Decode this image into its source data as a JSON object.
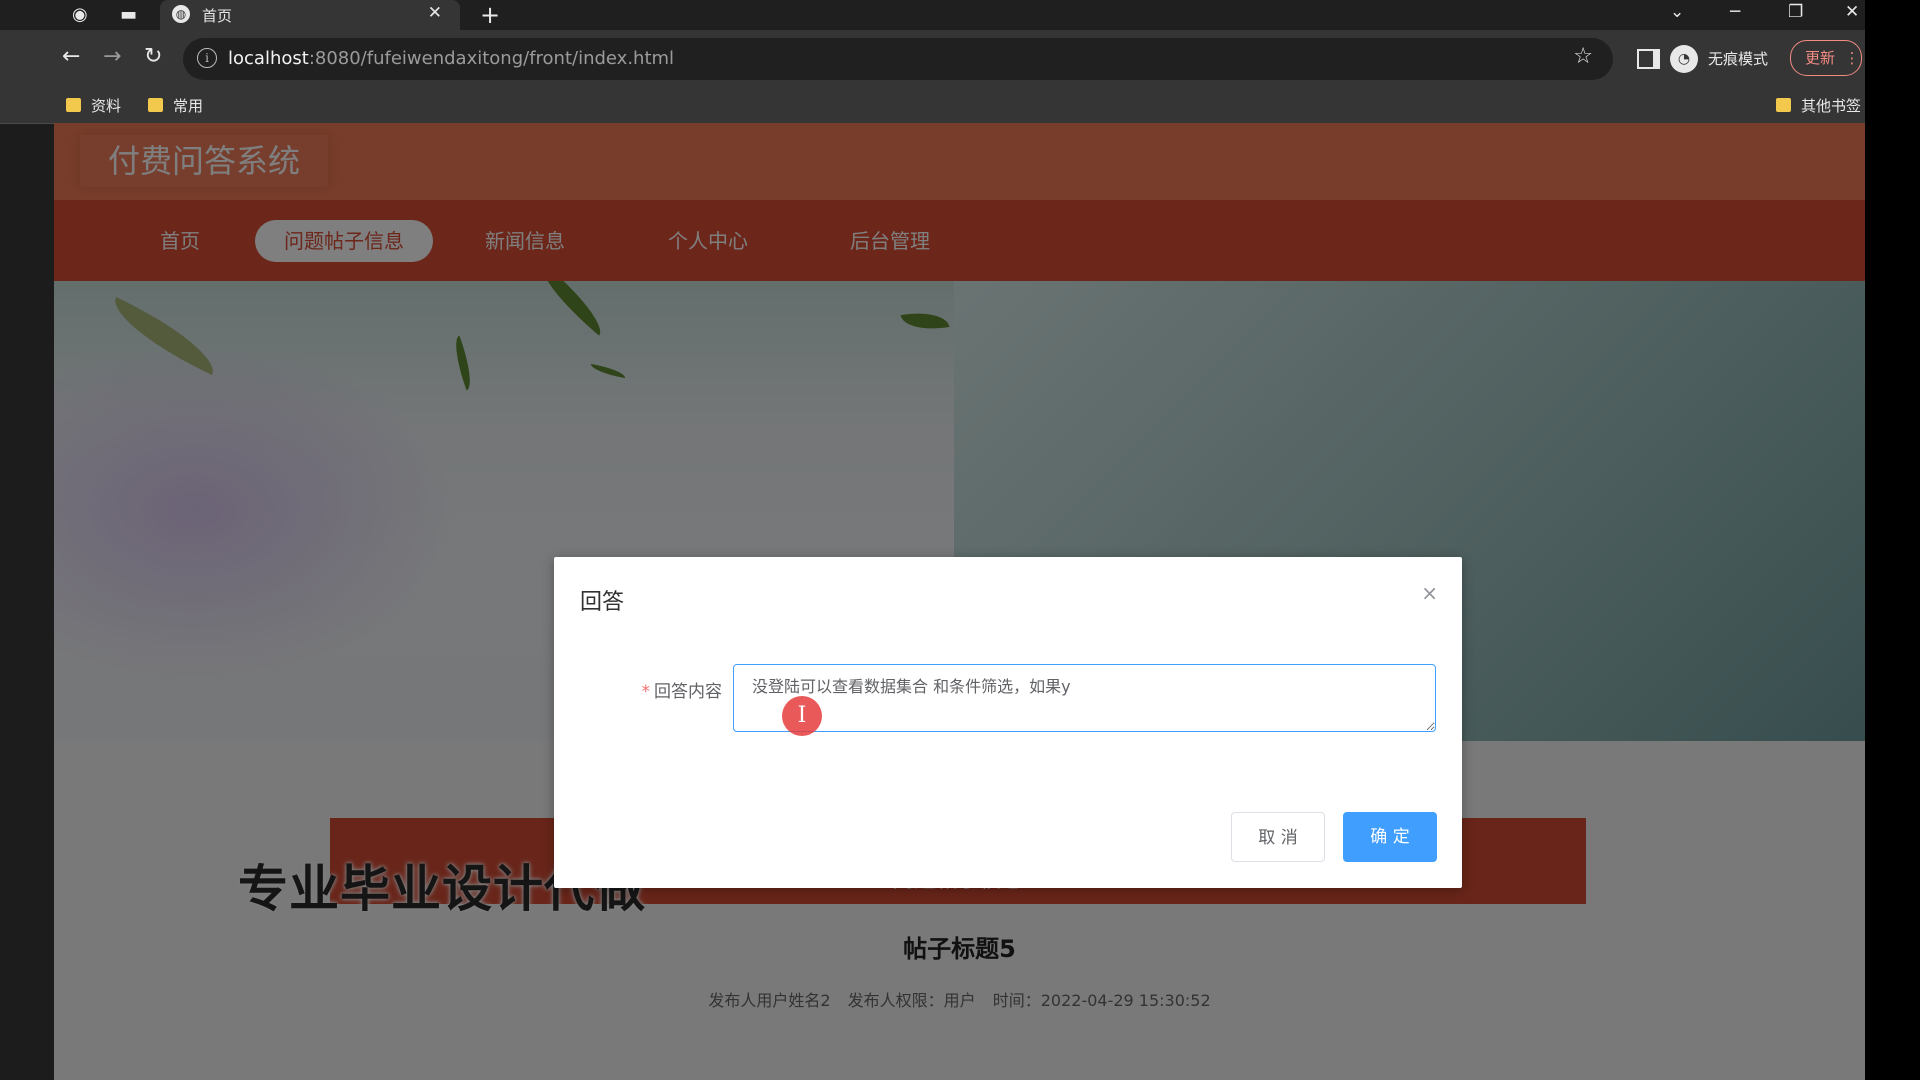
{
  "browser": {
    "tab_title": "首页",
    "tab_close": "✕",
    "new_tab": "+",
    "url_host": "localhost",
    "url_rest": ":8080/fufeiwendaxitong/front/index.html",
    "incognito_label": "无痕模式",
    "update_label": "更新",
    "bookmarks": [
      "资料",
      "常用"
    ],
    "other_bookmarks": "其他书签"
  },
  "site": {
    "logo": "付费问答系统",
    "nav": [
      "首页",
      "问题帖子信息",
      "新闻信息",
      "个人中心",
      "后台管理"
    ],
    "active_nav_index": 1
  },
  "section": {
    "en": "FORUM / INFORMATION",
    "cn": "问题帖子信息"
  },
  "watermark": "专业毕业设计代做",
  "post": {
    "title": "帖子标题5",
    "publisher": "发布人用户姓名2",
    "role": "发布人权限：用户",
    "time": "时间：2022-04-29 15:30:52"
  },
  "dialog": {
    "title": "回答",
    "close": "×",
    "label": "回答内容",
    "required_mark": "*",
    "answer_value": "没登陆可以查看数据集合 和条件筛选，如果y",
    "cancel": "取 消",
    "confirm": "确 定"
  }
}
